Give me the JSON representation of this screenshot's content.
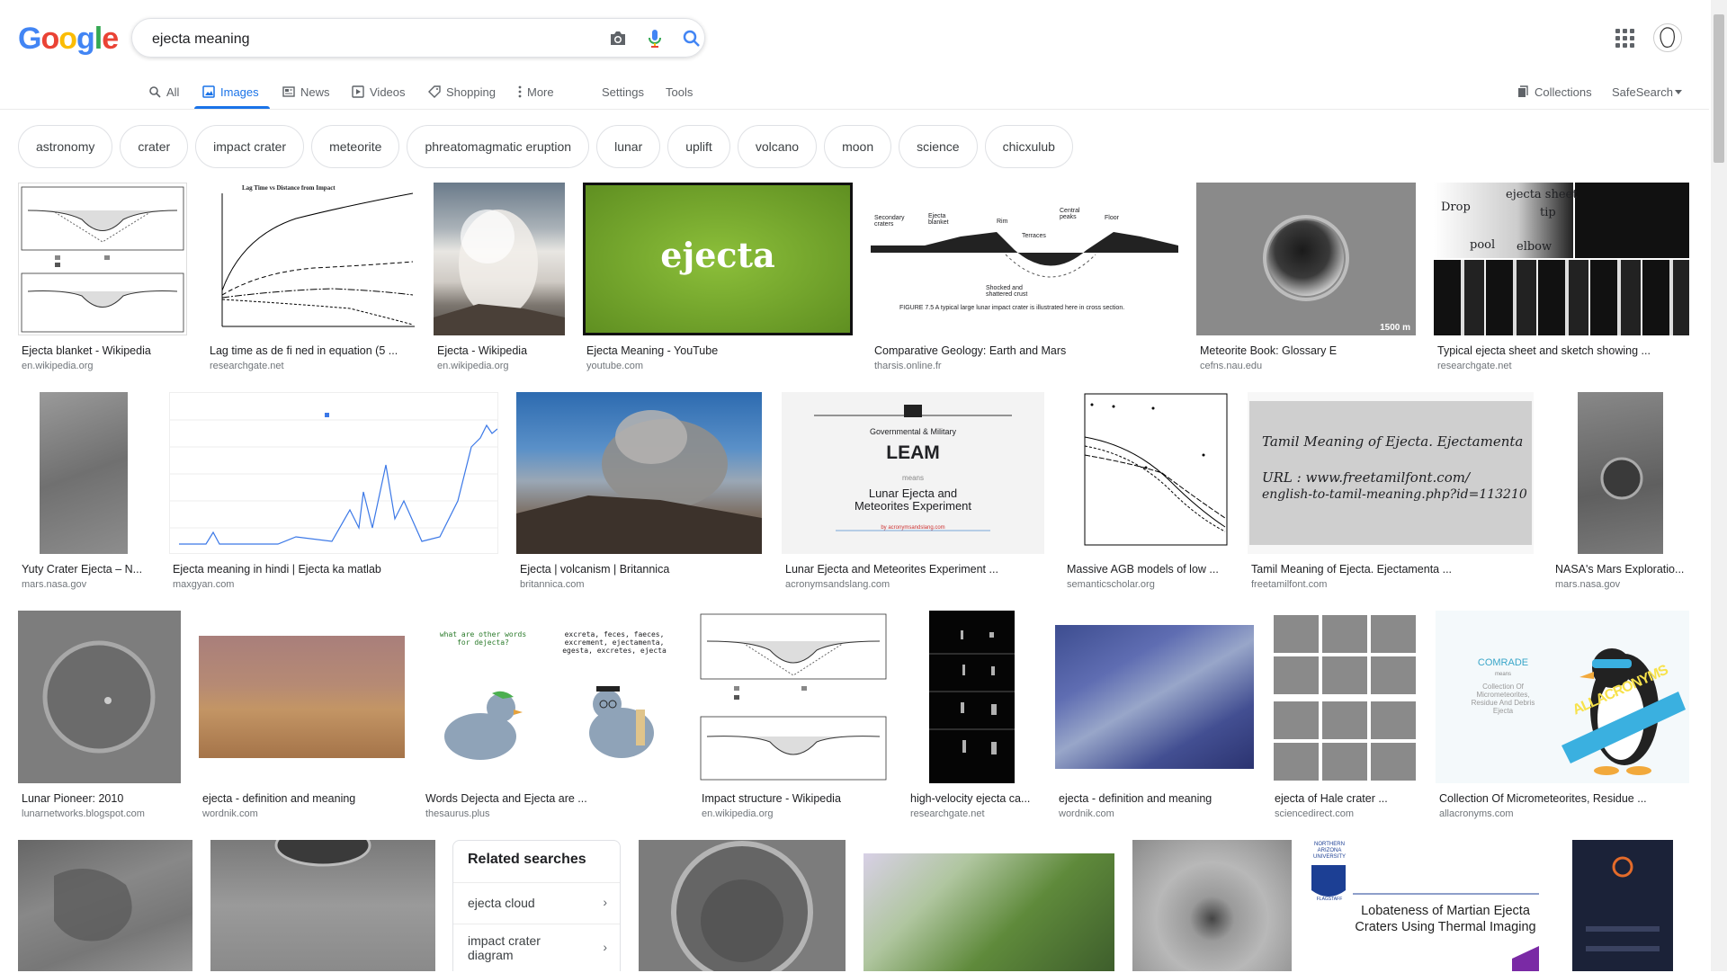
{
  "logo": {
    "letters": [
      "G",
      "o",
      "o",
      "g",
      "l",
      "e"
    ]
  },
  "search": {
    "query": "ejecta meaning"
  },
  "tabs": {
    "all": "All",
    "images": "Images",
    "news": "News",
    "videos": "Videos",
    "shopping": "Shopping",
    "more": "More",
    "settings": "Settings",
    "tools": "Tools",
    "collections": "Collections",
    "safesearch": "SafeSearch"
  },
  "chips": [
    "astronomy",
    "crater",
    "impact crater",
    "meteorite",
    "phreatomagmatic eruption",
    "lunar",
    "uplift",
    "volcano",
    "moon",
    "science",
    "chicxulub"
  ],
  "thumb_texts": {
    "lag_title": "Lag Time vs Distance from Impact",
    "ejecta_word": "ejecta",
    "sheet_labels": [
      "Drop",
      "pool",
      "ejecta sheet",
      "tip",
      "elbow"
    ],
    "geology_labels": [
      "Secondary craters",
      "Ejecta blanket",
      "Rim",
      "Terraces",
      "Central peaks",
      "Floor",
      "Shocked and shattered crust"
    ],
    "geology_caption": "FIGURE 7.5  A typical large lunar impact crater is illustrated here in cross section.",
    "scale": "1500 m",
    "leam_small": "Governmental & Military",
    "leam_big": "LEAM",
    "leam_means": "means",
    "leam_full": "Lunar Ejecta and Meteorites Experiment",
    "leam_by": "by acronymsandslang.com",
    "tamil_line1": "Tamil Meaning of Ejecta. Ejectamenta",
    "tamil_line2": "URL : www.freetamilfont.com/",
    "tamil_line3": "english-to-tamil-meaning.php?id=113210",
    "pigeon_q": "what are other words for dejecta?",
    "pigeon_a": "excreta, feces, faeces, excrement, ejectamenta, egesta, excretes, ejecta",
    "comrade": "COMRADE",
    "comrade_means": "means",
    "comrade_full": "Collection Of Micrometeorites, Residue And Debris Ejecta",
    "allacronyms": "ALLACRONYMS",
    "lobateness_uni": "NORTHERN ARIZONA UNIVERSITY",
    "lobateness_place": "FLAGSTAFF",
    "lobateness_title": "Lobateness of Martian Ejecta Craters Using Thermal Imaging"
  },
  "results": [
    {
      "caption": "Ejecta blanket - Wikipedia",
      "source": "en.wikipedia.org"
    },
    {
      "caption": "Lag time as de fi ned in equation (5 ...",
      "source": "researchgate.net"
    },
    {
      "caption": "Ejecta - Wikipedia",
      "source": "en.wikipedia.org"
    },
    {
      "caption": "Ejecta Meaning - YouTube",
      "source": "youtube.com"
    },
    {
      "caption": "Comparative Geology: Earth and Mars",
      "source": "tharsis.online.fr"
    },
    {
      "caption": "Meteorite Book: Glossary E",
      "source": "cefns.nau.edu"
    },
    {
      "caption": "Typical ejecta sheet and sketch showing ...",
      "source": "researchgate.net"
    },
    {
      "caption": "Yuty Crater Ejecta – N...",
      "source": "mars.nasa.gov"
    },
    {
      "caption": "Ejecta meaning in hindi | Ejecta ka matlab",
      "source": "maxgyan.com"
    },
    {
      "caption": "Ejecta | volcanism | Britannica",
      "source": "britannica.com"
    },
    {
      "caption": "Lunar Ejecta and Meteorites Experiment ...",
      "source": "acronymsandslang.com"
    },
    {
      "caption": "Massive AGB models of low ...",
      "source": "semanticscholar.org"
    },
    {
      "caption": "Tamil Meaning of Ejecta. Ejectamenta ...",
      "source": "freetamilfont.com"
    },
    {
      "caption": "NASA's Mars Exploratio...",
      "source": "mars.nasa.gov"
    },
    {
      "caption": "Lunar Pioneer: 2010",
      "source": "lunarnetworks.blogspot.com"
    },
    {
      "caption": "ejecta - definition and meaning",
      "source": "wordnik.com"
    },
    {
      "caption": "Words Dejecta and Ejecta are ...",
      "source": "thesaurus.plus"
    },
    {
      "caption": "Impact structure - Wikipedia",
      "source": "en.wikipedia.org"
    },
    {
      "caption": "high-velocity ejecta ca...",
      "source": "researchgate.net"
    },
    {
      "caption": "ejecta - definition and meaning",
      "source": "wordnik.com"
    },
    {
      "caption": "ejecta of Hale crater ...",
      "source": "sciencedirect.com"
    },
    {
      "caption": "Collection Of Micrometeorites, Residue ...",
      "source": "allacronyms.com"
    }
  ],
  "related": {
    "title": "Related searches",
    "items": [
      "ejecta cloud",
      "impact crater diagram"
    ]
  },
  "colors": {
    "blue": "#4285f4",
    "red": "#ea4335",
    "yellow": "#fbbc05",
    "green": "#34a853",
    "accent": "#1a73e8"
  }
}
